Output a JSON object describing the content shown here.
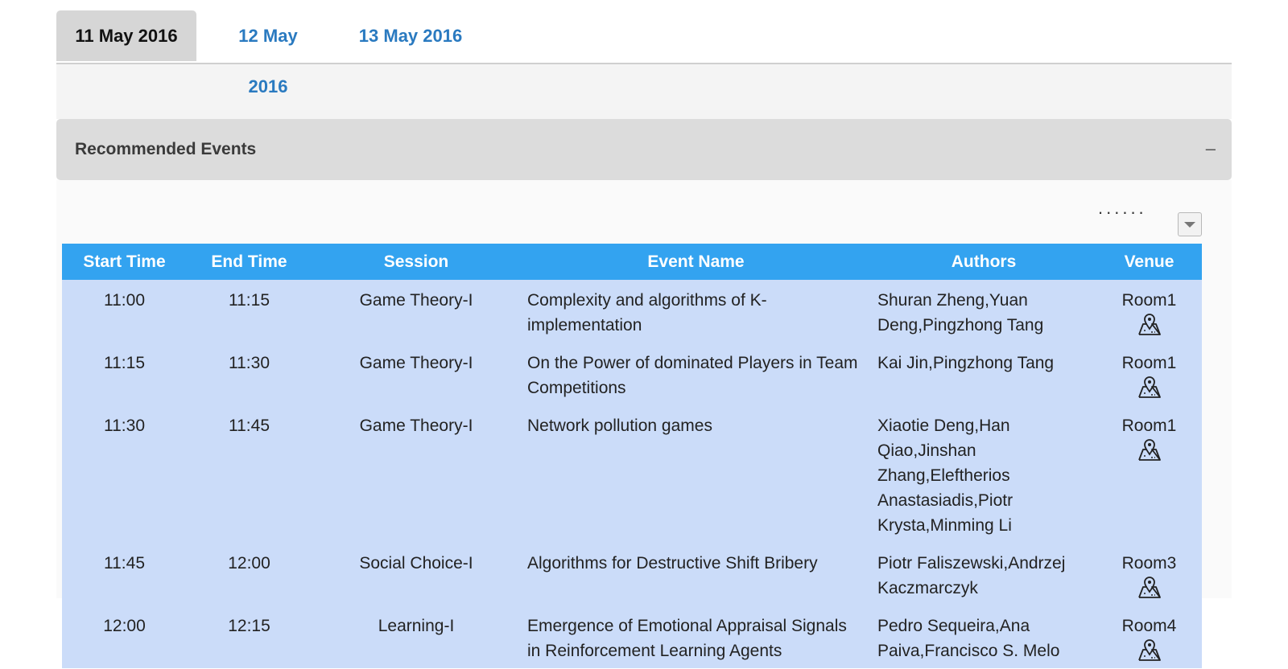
{
  "tabs": [
    {
      "label": "11 May 2016",
      "active": true
    },
    {
      "label": "12 May 2016",
      "active": false
    },
    {
      "label": "13 May 2016",
      "active": false
    }
  ],
  "panel": {
    "title": "Recommended Events",
    "collapse_glyph": "–",
    "more_glyph": "......"
  },
  "table": {
    "headers": [
      "Start Time",
      "End Time",
      "Session",
      "Event Name",
      "Authors",
      "Venue"
    ],
    "rows": [
      {
        "start": "11:00",
        "end": "11:15",
        "session": "Game Theory-I",
        "event": "Complexity and algorithms of K-implementation",
        "authors": "Shuran Zheng,Yuan Deng,Pingzhong Tang",
        "venue": "Room1"
      },
      {
        "start": "11:15",
        "end": "11:30",
        "session": "Game Theory-I",
        "event": "On the Power of dominated Players in Team Competitions",
        "authors": "Kai Jin,Pingzhong Tang",
        "venue": "Room1"
      },
      {
        "start": "11:30",
        "end": "11:45",
        "session": "Game Theory-I",
        "event": "Network pollution games",
        "authors": "Xiaotie Deng,Han Qiao,Jinshan Zhang,Eleftherios Anastasiadis,Piotr Krysta,Minming Li",
        "venue": "Room1"
      },
      {
        "start": "11:45",
        "end": "12:00",
        "session": "Social Choice-I",
        "event": "Algorithms for Destructive Shift Bribery",
        "authors": "Piotr Faliszewski,Andrzej Kaczmarczyk",
        "venue": "Room3"
      },
      {
        "start": "12:00",
        "end": "12:15",
        "session": "Learning-I",
        "event": "Emergence of Emotional Appraisal Signals in Reinforcement Learning Agents",
        "authors": "Pedro Sequeira,Ana Paiva,Francisco S. Melo",
        "venue": "Room4"
      }
    ]
  },
  "icons": {
    "venue": "map-pin-icon",
    "dropdown": "caret-down-icon"
  },
  "colors": {
    "header": "#33a3f0",
    "row": "#cbdcf9",
    "tab_link": "#2a7ac0"
  }
}
